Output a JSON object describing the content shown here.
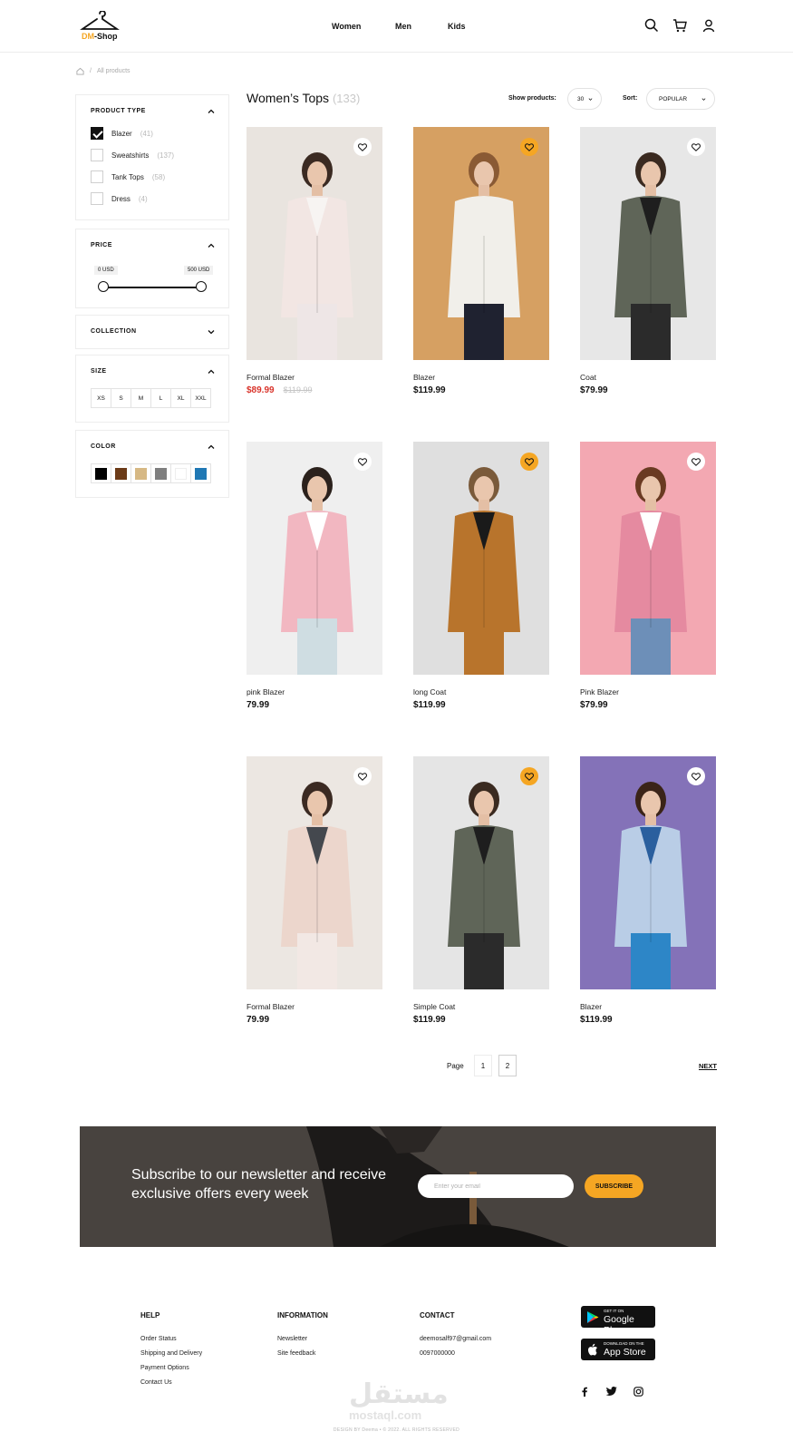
{
  "brand": {
    "name_a": "DM",
    "name_b": "-Shop",
    "accent": "#f5a623"
  },
  "nav": {
    "women": "Women",
    "men": "Men",
    "kids": "Kids"
  },
  "header_icons": [
    "search-icon",
    "cart-icon",
    "user-icon"
  ],
  "breadcrumb": {
    "home_icon": "home-icon",
    "sep": "/",
    "current": "All products"
  },
  "filters": {
    "product_type": {
      "title": "PRODUCT TYPE",
      "items": [
        {
          "label": "Blazer",
          "count": "(41)",
          "checked": true
        },
        {
          "label": "Sweatshirts",
          "count": "(137)",
          "checked": false
        },
        {
          "label": "Tank Tops",
          "count": "(58)",
          "checked": false
        },
        {
          "label": "Dress",
          "count": "(4)",
          "checked": false
        }
      ]
    },
    "price": {
      "title": "PRICE",
      "min": "0 USD",
      "max": "500 USD",
      "min_value": 0,
      "max_value": 500
    },
    "collection": {
      "title": "COLLECTION"
    },
    "size": {
      "title": "SIZE",
      "options": [
        "XS",
        "S",
        "M",
        "L",
        "XL",
        "XXL"
      ]
    },
    "color": {
      "title": "COLOR",
      "swatches": [
        "#000000",
        "#6b3a17",
        "#d6b884",
        "#7f7f7f",
        "#ffffff",
        "#1f78b4"
      ]
    }
  },
  "listing": {
    "title": "Women’s Tops",
    "count": "(133)",
    "show_label": "Show products:",
    "show_value": "30",
    "sort_label": "Sort:",
    "sort_value": "POPULAR"
  },
  "products": [
    {
      "name": "Formal Blazer",
      "price": "$89.99",
      "old_price": "$119.99",
      "on_sale": true,
      "favorite": false,
      "bg": "#e9e4df",
      "coat": "#f2e6e3",
      "top": "#f7f4f2",
      "bottom": "#eee6e6",
      "hair": "#3b2a22"
    },
    {
      "name": "Blazer",
      "price": "$119.99",
      "old_price": "",
      "on_sale": false,
      "favorite": true,
      "bg": "#d6a062",
      "coat": "#f1efea",
      "top": "#f1efea",
      "bottom": "#1f2230",
      "hair": "#8a5a34"
    },
    {
      "name": "Coat",
      "price": "$79.99",
      "old_price": "",
      "on_sale": false,
      "favorite": false,
      "bg": "#e7e7e7",
      "coat": "#5f6558",
      "top": "#1e1e1e",
      "bottom": "#2b2b2b",
      "hair": "#3a2a20"
    },
    {
      "name": "pink Blazer",
      "price": "79.99",
      "old_price": "",
      "on_sale": false,
      "favorite": false,
      "bg": "#efefef",
      "coat": "#f2b7c1",
      "top": "#ffffff",
      "bottom": "#cfdde2",
      "hair": "#2b211c"
    },
    {
      "name": "long Coat",
      "price": "$119.99",
      "old_price": "",
      "on_sale": false,
      "favorite": true,
      "bg": "#dfdfdf",
      "coat": "#b8742c",
      "top": "#1a1a1a",
      "bottom": "#b8742c",
      "hair": "#7a5a3a"
    },
    {
      "name": "Pink Blazer",
      "price": "$79.99",
      "old_price": "",
      "on_sale": false,
      "favorite": false,
      "bg": "#f3a8b2",
      "coat": "#e58aa0",
      "top": "#ffffff",
      "bottom": "#6d8fb8",
      "hair": "#6a3a22"
    },
    {
      "name": "Formal Blazer",
      "price": "79.99",
      "old_price": "",
      "on_sale": false,
      "favorite": false,
      "bg": "#ece7e2",
      "coat": "#ecd6cc",
      "top": "#44484e",
      "bottom": "#f2e8e4",
      "hair": "#3b2a22"
    },
    {
      "name": "Simple Coat",
      "price": "$119.99",
      "old_price": "",
      "on_sale": false,
      "favorite": true,
      "bg": "#e5e5e5",
      "coat": "#5f6558",
      "top": "#1e1e1e",
      "bottom": "#2b2b2b",
      "hair": "#3a2a20"
    },
    {
      "name": "Blazer",
      "price": "$119.99",
      "old_price": "",
      "on_sale": false,
      "favorite": false,
      "bg": "#8472b8",
      "coat": "#b9cde6",
      "top": "#2a5f9e",
      "bottom": "#2d86c7",
      "hair": "#3b2418"
    }
  ],
  "pagination": {
    "label": "Page",
    "pages": [
      "1",
      "2"
    ],
    "current": "2",
    "next": "NEXT"
  },
  "newsletter": {
    "title": "Subscribe to our newsletter and receive exclusive offers every week",
    "placeholder": "Enter your email",
    "button": "SUBSCRIBE"
  },
  "footer": {
    "help": {
      "title": "HELP",
      "links": [
        "Order Status",
        "Shipping and Delivery",
        "Payment Options",
        "Contact Us"
      ]
    },
    "information": {
      "title": "INFORMATION",
      "links": [
        "Newsletter",
        "Site feedback"
      ]
    },
    "contact": {
      "title": "CONTACT",
      "email": "deemosalf97@gmail.com",
      "phone": "0097000000"
    },
    "google_play": {
      "small": "GET IT ON",
      "big": "Google Play"
    },
    "app_store": {
      "small": "Download on the",
      "big": "App Store"
    },
    "social": [
      "facebook-icon",
      "twitter-icon",
      "instagram-icon"
    ],
    "watermark_ar": "مستقل",
    "watermark_en": "mostaql.com",
    "credit": "DESIGN BY Deema • © 2022. ALL RIGHTS RESERVED"
  }
}
